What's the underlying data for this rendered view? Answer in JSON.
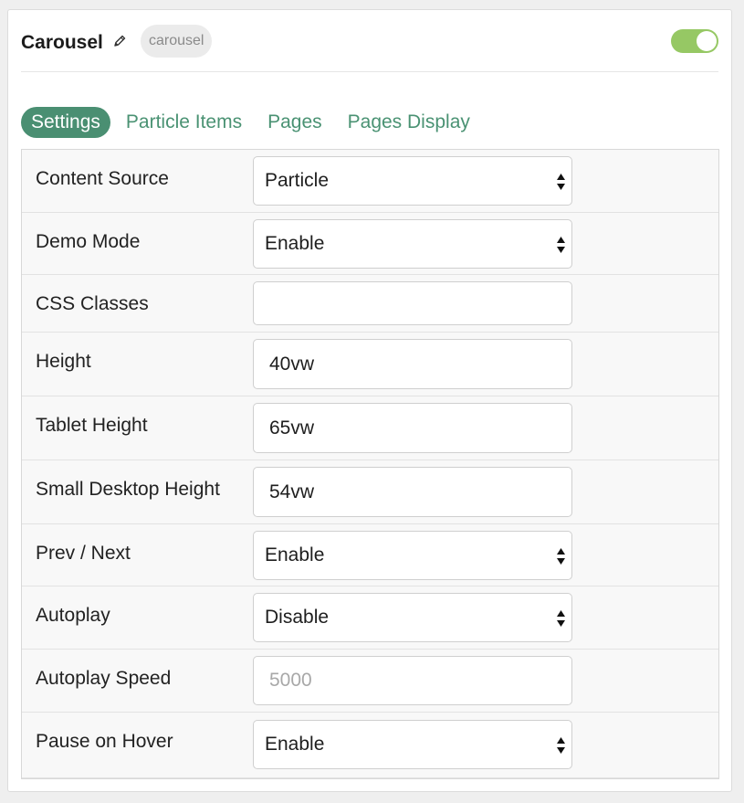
{
  "header": {
    "title": "Carousel",
    "badge": "carousel",
    "enabled": true,
    "toggle_color": "#96c864"
  },
  "tabs": [
    {
      "label": "Settings",
      "active": true
    },
    {
      "label": "Particle Items",
      "active": false
    },
    {
      "label": "Pages",
      "active": false
    },
    {
      "label": "Pages Display",
      "active": false
    }
  ],
  "fields": {
    "content_source": {
      "label": "Content Source",
      "value": "Particle"
    },
    "demo_mode": {
      "label": "Demo Mode",
      "value": "Enable"
    },
    "css_classes": {
      "label": "CSS Classes",
      "value": ""
    },
    "height": {
      "label": "Height",
      "value": "40vw"
    },
    "tablet_height": {
      "label": "Tablet Height",
      "value": "65vw"
    },
    "small_desktop_height": {
      "label": "Small Desktop Height",
      "value": "54vw"
    },
    "prev_next": {
      "label": "Prev / Next",
      "value": "Enable"
    },
    "autoplay": {
      "label": "Autoplay",
      "value": "Disable"
    },
    "autoplay_speed": {
      "label": "Autoplay Speed",
      "value": "",
      "placeholder": "5000"
    },
    "pause_on_hover": {
      "label": "Pause on Hover",
      "value": "Enable"
    }
  },
  "colors": {
    "accent": "#4a8f72",
    "tab_text": "#4a9273"
  }
}
